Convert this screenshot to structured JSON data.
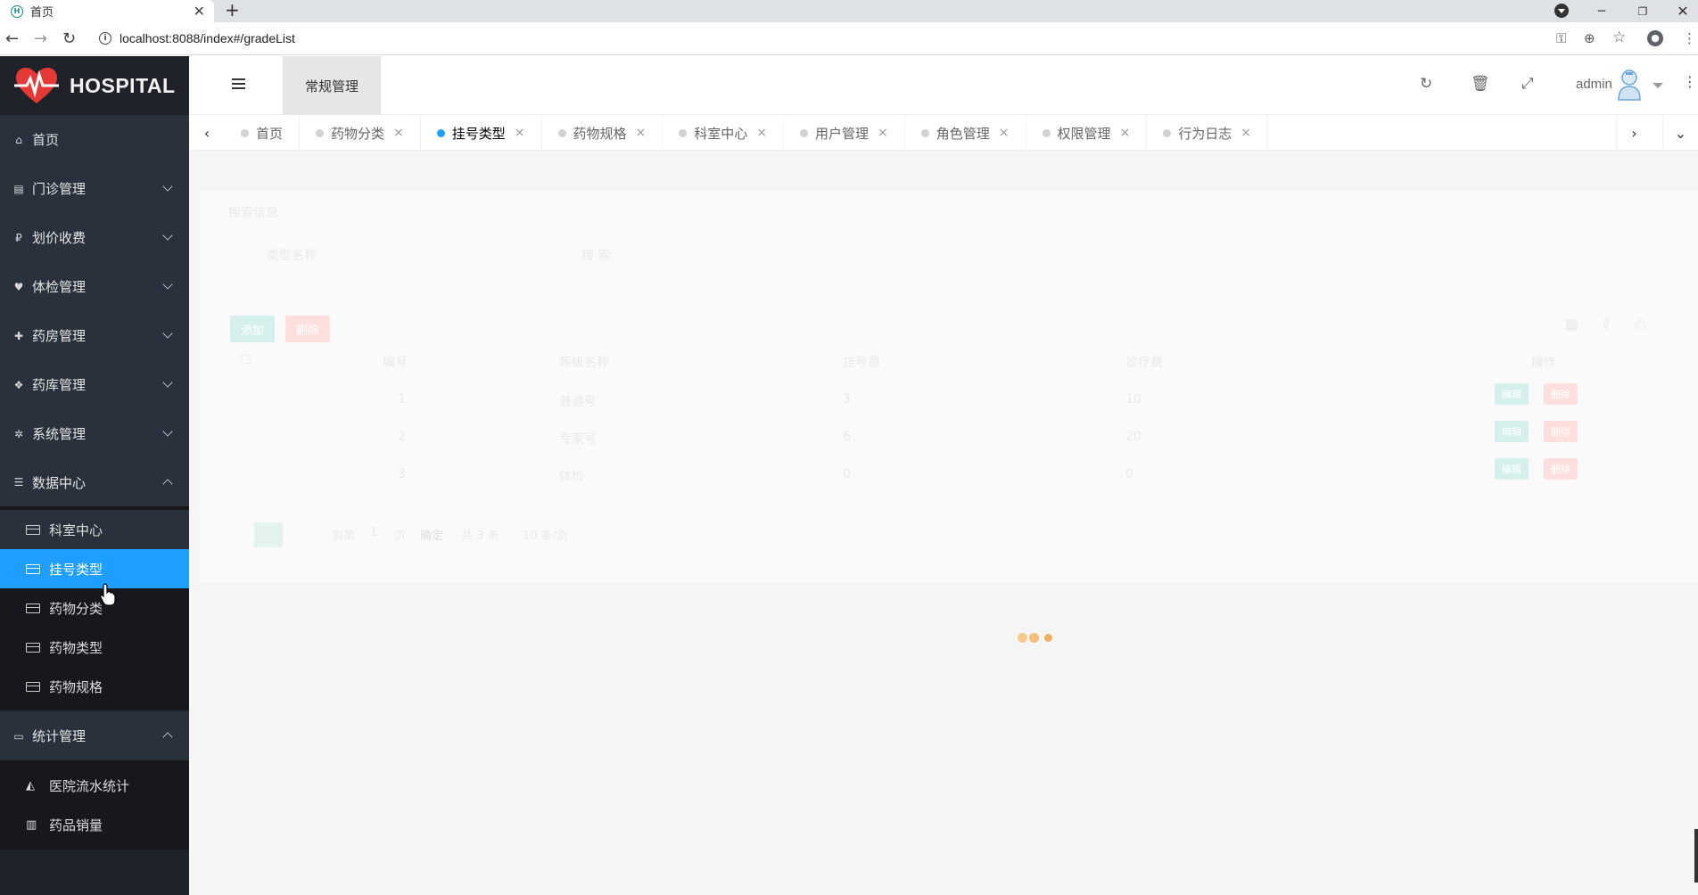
{
  "browser": {
    "tab_title": "首页",
    "new_tab_label": "+",
    "url": "localhost:8088/index#/gradeList"
  },
  "app": {
    "logo_text": "HOSPITAL",
    "brand_color": "#e53935",
    "sidebar_bg": "#20222a",
    "active_color": "#1e9fff"
  },
  "sidebar": {
    "items": [
      {
        "label": "首页",
        "icon": "home-icon"
      },
      {
        "label": "门诊管理",
        "icon": "clipboard-icon"
      },
      {
        "label": "划价收费",
        "icon": "currency-icon"
      },
      {
        "label": "体检管理",
        "icon": "heartbeat-icon"
      },
      {
        "label": "药房管理",
        "icon": "medkit-icon"
      },
      {
        "label": "药库管理",
        "icon": "cubes-icon"
      },
      {
        "label": "系统管理",
        "icon": "gear-icon"
      },
      {
        "label": "数据中心",
        "icon": "database-icon"
      }
    ],
    "data_center_sub": [
      {
        "label": "科室中心"
      },
      {
        "label": "挂号类型"
      },
      {
        "label": "药物分类"
      },
      {
        "label": "药物类型"
      },
      {
        "label": "药物规格"
      }
    ],
    "stats_label": "统计管理",
    "stats_sub": [
      {
        "label": "医院流水统计"
      },
      {
        "label": "药品销量"
      }
    ]
  },
  "header": {
    "tab_label": "常规管理",
    "user": "admin"
  },
  "page_tabs": [
    {
      "label": "首页",
      "closable": false
    },
    {
      "label": "药物分类",
      "closable": true
    },
    {
      "label": "挂号类型",
      "closable": true,
      "active": true
    },
    {
      "label": "药物规格",
      "closable": true
    },
    {
      "label": "科室中心",
      "closable": true
    },
    {
      "label": "用户管理",
      "closable": true
    },
    {
      "label": "角色管理",
      "closable": true
    },
    {
      "label": "权限管理",
      "closable": true
    },
    {
      "label": "行为日志",
      "closable": true
    }
  ],
  "content": {
    "search_title": "搜索信息",
    "search_placeholder": "类型名称",
    "search_button": "搜 索",
    "add_button": "添加",
    "delete_button": "删除",
    "columns": [
      "编号",
      "等级名称",
      "挂号费",
      "诊疗费",
      "操作"
    ],
    "rows": [
      {
        "id": "1",
        "name": "普通号",
        "fee": "3",
        "treat": "10"
      },
      {
        "id": "2",
        "name": "专家号",
        "fee": "6",
        "treat": "20"
      },
      {
        "id": "3",
        "name": "体检",
        "fee": "0",
        "treat": "0"
      }
    ],
    "edit_label": "编辑",
    "row_delete_label": "删除",
    "pager": {
      "current": "1",
      "goto": "到第",
      "page_input": "1",
      "page_unit": "页",
      "confirm": "确定",
      "total": "共 3 条",
      "per_page": "10 条/页"
    }
  }
}
